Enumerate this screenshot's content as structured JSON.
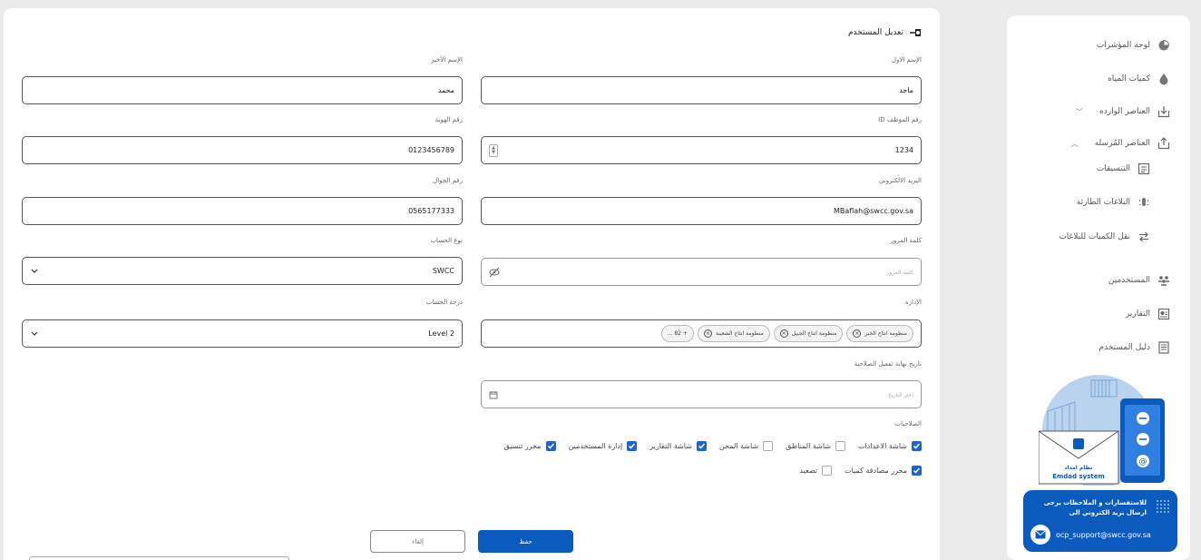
{
  "page": {
    "title": "تعديل المستخدم"
  },
  "form": {
    "first_name": {
      "label": "الإسم الاول",
      "value": "ماجد"
    },
    "last_name": {
      "label": "الإسم الأخير",
      "value": "محمد"
    },
    "employee_id": {
      "label": "رقم الموظف ID",
      "value": "1234"
    },
    "id_number": {
      "label": "رقم الهوية",
      "value": "0123456789"
    },
    "email": {
      "label": "البريد الالكتروني",
      "value": "MBaflah@swcc.gov.sa"
    },
    "mobile": {
      "label": "رقم الجوال",
      "value": "0565177333"
    },
    "password": {
      "label": "كلمة المرور",
      "placeholder": "كلمة المرور"
    },
    "account_type": {
      "label": "نوع الحساب",
      "value": "SWCC"
    },
    "department": {
      "label": "الإدارة",
      "chips": [
        "منظومة انتاج الخبر",
        "منظومة انتاج الجبيل",
        "منظومة انتاج الشعيبة"
      ],
      "more": "+ 82 ..."
    },
    "account_level": {
      "label": "درجة الحساب",
      "value": "Level 2"
    },
    "expiry_date": {
      "label": "تاريخ نهاية تفعيل الصلاحية",
      "placeholder": "اختر التاريخ"
    },
    "permissions": {
      "label": "الصلاحيات",
      "row1": [
        {
          "label": "شاشة الاعدادات",
          "checked": true
        },
        {
          "label": "شاشة المناطق",
          "checked": false
        },
        {
          "label": "شاشة المحن",
          "checked": false
        },
        {
          "label": "شاشة التقارير",
          "checked": true
        },
        {
          "label": "إدارة المستخدمين",
          "checked": true
        },
        {
          "label": "محرر تنسيق",
          "checked": true
        }
      ],
      "row2": [
        {
          "label": "محرر مصادقة كميات",
          "checked": true
        },
        {
          "label": "تصعيد",
          "checked": false
        }
      ]
    },
    "save_label": "حفظ",
    "cancel_label": "إلغاء"
  },
  "sidebar": {
    "items": [
      {
        "label": "لوحة المؤشرات",
        "icon": "pie-chart-icon"
      },
      {
        "label": "كميات المياه",
        "icon": "water-drop-icon"
      },
      {
        "label": "العناصر الوارده",
        "icon": "download-icon"
      },
      {
        "label": "العناصر المُرسله",
        "icon": "upload-icon"
      },
      {
        "label": "التنسيقات",
        "icon": "calendar-icon"
      },
      {
        "label": "البلاغات الطارئة",
        "icon": "alarm-icon"
      },
      {
        "label": "نقل الكميات للبلاغات",
        "icon": "transfer-icon"
      },
      {
        "label": "المستخدمين",
        "icon": "users-icon"
      },
      {
        "label": "التقارير",
        "icon": "report-icon"
      },
      {
        "label": "دليل المستخدم",
        "icon": "book-icon"
      }
    ]
  },
  "promo": {
    "logo_text": "نظام امداد",
    "logo_sub": "Emdad system"
  },
  "support": {
    "text_line1": "للاستفسارات و الملاحظات يرجى",
    "text_line2": "ارسال بريد الكتروني الى",
    "email": "ocp_support@swcc.gov.sa"
  }
}
